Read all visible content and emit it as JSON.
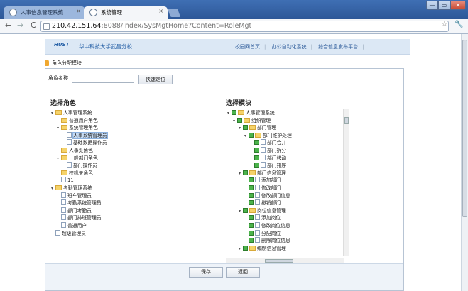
{
  "browser": {
    "tabs": [
      {
        "title": "人事信息管理系统",
        "active": false
      },
      {
        "title": "系统管理",
        "active": true
      }
    ],
    "url_host": "210.42.151.64",
    "url_rest": ":8088/Index/SysMgtHome?Content=RoleMgt",
    "window_controls": {
      "minimize": "—",
      "maximize": "▭",
      "close": "✕"
    },
    "nav_icons": {
      "back": "←",
      "forward": "→",
      "reload": "C",
      "star": "☆",
      "wrench": "🔧"
    }
  },
  "banner": {
    "logo_text": "HUST",
    "school": "华中科技大学武昌分校",
    "links": [
      "校园网首页",
      "办公自动化系统",
      "综合信息发布平台"
    ]
  },
  "module_title": "角色分配模块",
  "role_search": {
    "label": "角色名称",
    "value": "",
    "button": "快速定位"
  },
  "role_section": {
    "title": "选择角色",
    "items": [
      {
        "label": "人事管理系统",
        "indent": 0,
        "icon": "folder",
        "exp": "▾"
      },
      {
        "label": "普通用户角色",
        "indent": 1,
        "icon": "folder",
        "exp": ""
      },
      {
        "label": "系统管理角色",
        "indent": 1,
        "icon": "folder",
        "exp": "▾"
      },
      {
        "label": "人事系统管理员",
        "indent": 2,
        "icon": "doc",
        "exp": "",
        "selected": true
      },
      {
        "label": "基础数据操作员",
        "indent": 2,
        "icon": "doc",
        "exp": ""
      },
      {
        "label": "人事处角色",
        "indent": 1,
        "icon": "folder",
        "exp": ""
      },
      {
        "label": "一般部门角色",
        "indent": 1,
        "icon": "folder",
        "exp": "▾"
      },
      {
        "label": "部门操作员",
        "indent": 2,
        "icon": "doc",
        "exp": ""
      },
      {
        "label": "校机关角色",
        "indent": 1,
        "icon": "folder",
        "exp": ""
      },
      {
        "label": "11",
        "indent": 1,
        "icon": "doc",
        "exp": ""
      },
      {
        "label": "考勤管理系统",
        "indent": 0,
        "icon": "folder",
        "exp": "▾"
      },
      {
        "label": "班车管理员",
        "indent": 1,
        "icon": "doc",
        "exp": ""
      },
      {
        "label": "考勤系统管理员",
        "indent": 1,
        "icon": "doc",
        "exp": ""
      },
      {
        "label": "部门考勤员",
        "indent": 1,
        "icon": "doc",
        "exp": ""
      },
      {
        "label": "部门排班管理员",
        "indent": 1,
        "icon": "doc",
        "exp": ""
      },
      {
        "label": "普通用户",
        "indent": 1,
        "icon": "doc",
        "exp": ""
      },
      {
        "label": "超级管理员",
        "indent": 0,
        "icon": "doc",
        "exp": ""
      }
    ]
  },
  "module_section": {
    "title": "选择模块",
    "items": [
      {
        "label": "人事管理系统",
        "indent": 0,
        "exp": "▾"
      },
      {
        "label": "组织管理",
        "indent": 1,
        "exp": "▾"
      },
      {
        "label": "部门管理",
        "indent": 2,
        "exp": "▾"
      },
      {
        "label": "部门维护处理",
        "indent": 3,
        "exp": "▾"
      },
      {
        "label": "部门合并",
        "indent": 4,
        "exp": ""
      },
      {
        "label": "部门拆分",
        "indent": 4,
        "exp": ""
      },
      {
        "label": "部门移动",
        "indent": 4,
        "exp": ""
      },
      {
        "label": "部门排序",
        "indent": 4,
        "exp": ""
      },
      {
        "label": "部门信息管理",
        "indent": 2,
        "exp": "▾"
      },
      {
        "label": "添加部门",
        "indent": 3,
        "exp": ""
      },
      {
        "label": "修改部门",
        "indent": 3,
        "exp": ""
      },
      {
        "label": "修改部门信息",
        "indent": 3,
        "exp": ""
      },
      {
        "label": "撤销部门",
        "indent": 3,
        "exp": ""
      },
      {
        "label": "岗位信息管理",
        "indent": 2,
        "exp": "▾"
      },
      {
        "label": "添加岗位",
        "indent": 3,
        "exp": ""
      },
      {
        "label": "修改岗位信息",
        "indent": 3,
        "exp": ""
      },
      {
        "label": "分配岗位",
        "indent": 3,
        "exp": ""
      },
      {
        "label": "删除岗位信息",
        "indent": 3,
        "exp": ""
      },
      {
        "label": "编制信息管理",
        "indent": 2,
        "exp": "▾"
      }
    ]
  },
  "actions": {
    "save": "保存",
    "back": "返回"
  }
}
